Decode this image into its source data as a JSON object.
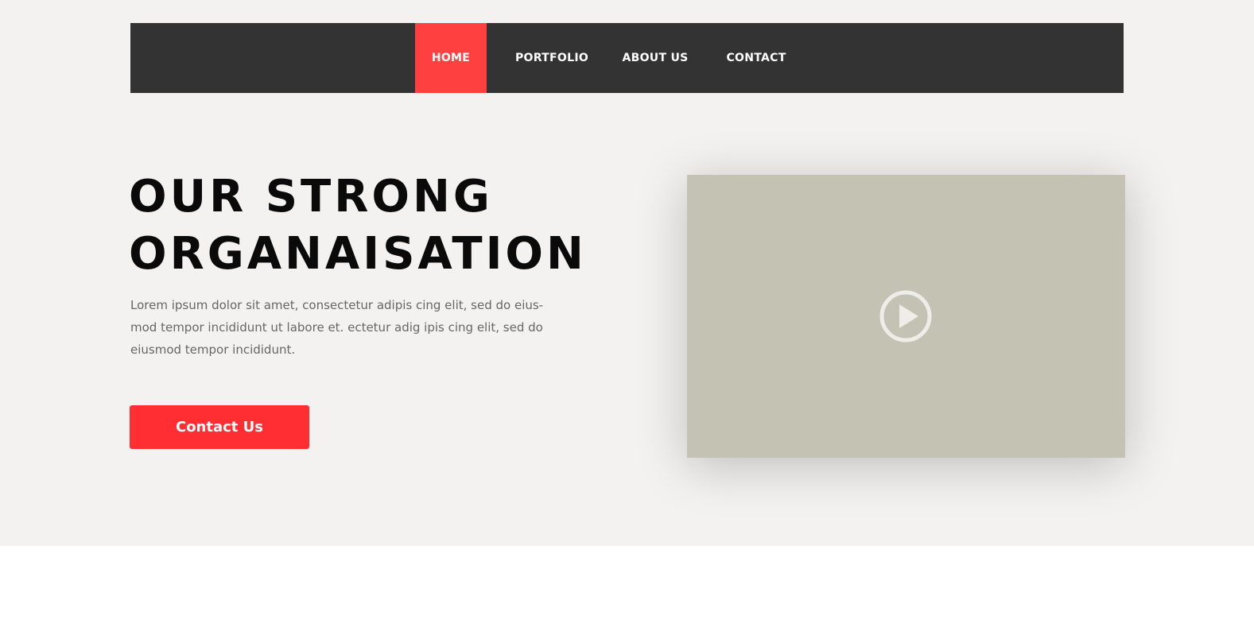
{
  "nav": {
    "items": [
      {
        "label": "HOME",
        "active": true
      },
      {
        "label": "PORTFOLIO",
        "active": false
      },
      {
        "label": "ABOUT US",
        "active": false
      },
      {
        "label": "CONTACT",
        "active": false
      }
    ]
  },
  "hero": {
    "headline_line1": "OUR STRONG",
    "headline_line2": "ORGANAISATION",
    "description": "Lorem ipsum dolor sit amet, consectetur adipis cing elit, sed do eius-mod tempor incididunt  ut labore et. ectetur adig ipis cing elit, sed do eiusmod tempor incididunt.",
    "cta_label": "Contact Us"
  },
  "video": {
    "icon": "play-circle-icon"
  },
  "colors": {
    "hero_background": "#f4f2f1",
    "navbar_background": "#333333",
    "nav_active": "#ff4040",
    "cta_background": "#ff2e33",
    "video_placeholder": "#c4c2b3",
    "headline_text": "#0a0a0a",
    "body_text": "#666666"
  }
}
